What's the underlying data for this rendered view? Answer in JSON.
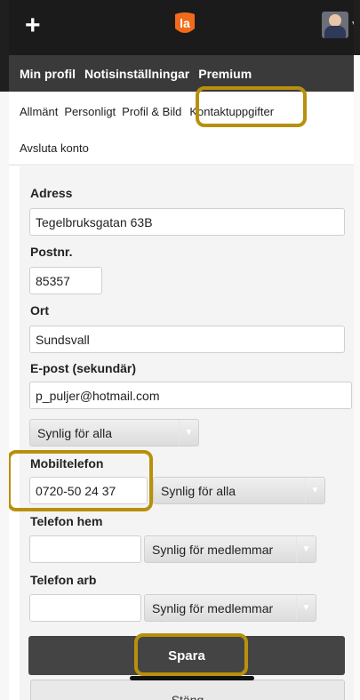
{
  "topbar": {
    "plus_glyph": "+",
    "logo_text": "la"
  },
  "tabs": [
    {
      "label": "Min profil"
    },
    {
      "label": "Notisinställningar"
    },
    {
      "label": "Premium"
    }
  ],
  "subtabs": [
    {
      "label": "Allmänt"
    },
    {
      "label": "Personligt"
    },
    {
      "label": "Profil & Bild"
    },
    {
      "label": "Kontaktuppgifter"
    }
  ],
  "delete_account": "Avsluta konto",
  "form": {
    "address": {
      "label": "Adress",
      "value": "Tegelbruksgatan 63B"
    },
    "postcode": {
      "label": "Postnr.",
      "value": "85357"
    },
    "city": {
      "label": "Ort",
      "value": "Sundsvall"
    },
    "email": {
      "label": "E-post (sekundär)",
      "value": "p_puljer@hotmail.com",
      "visibility": "Synlig för alla"
    },
    "mobile": {
      "label": "Mobiltelefon",
      "value": "0720-50 24 37",
      "visibility": "Synlig för alla"
    },
    "phone_home": {
      "label": "Telefon hem",
      "value": "",
      "visibility": "Synlig för medlemmar"
    },
    "phone_work": {
      "label": "Telefon arb",
      "value": "",
      "visibility": "Synlig för medlemmar"
    }
  },
  "buttons": {
    "save": "Spara",
    "close": "Stäng"
  },
  "colors": {
    "highlight": "#b8900c",
    "logo_orange": "#f26a1b",
    "topbar": "#1b1b1b",
    "tabbar": "#3a3a3a"
  },
  "icons": [
    "plus-icon",
    "la-logo",
    "avatar",
    "chevron-down-icon"
  ]
}
